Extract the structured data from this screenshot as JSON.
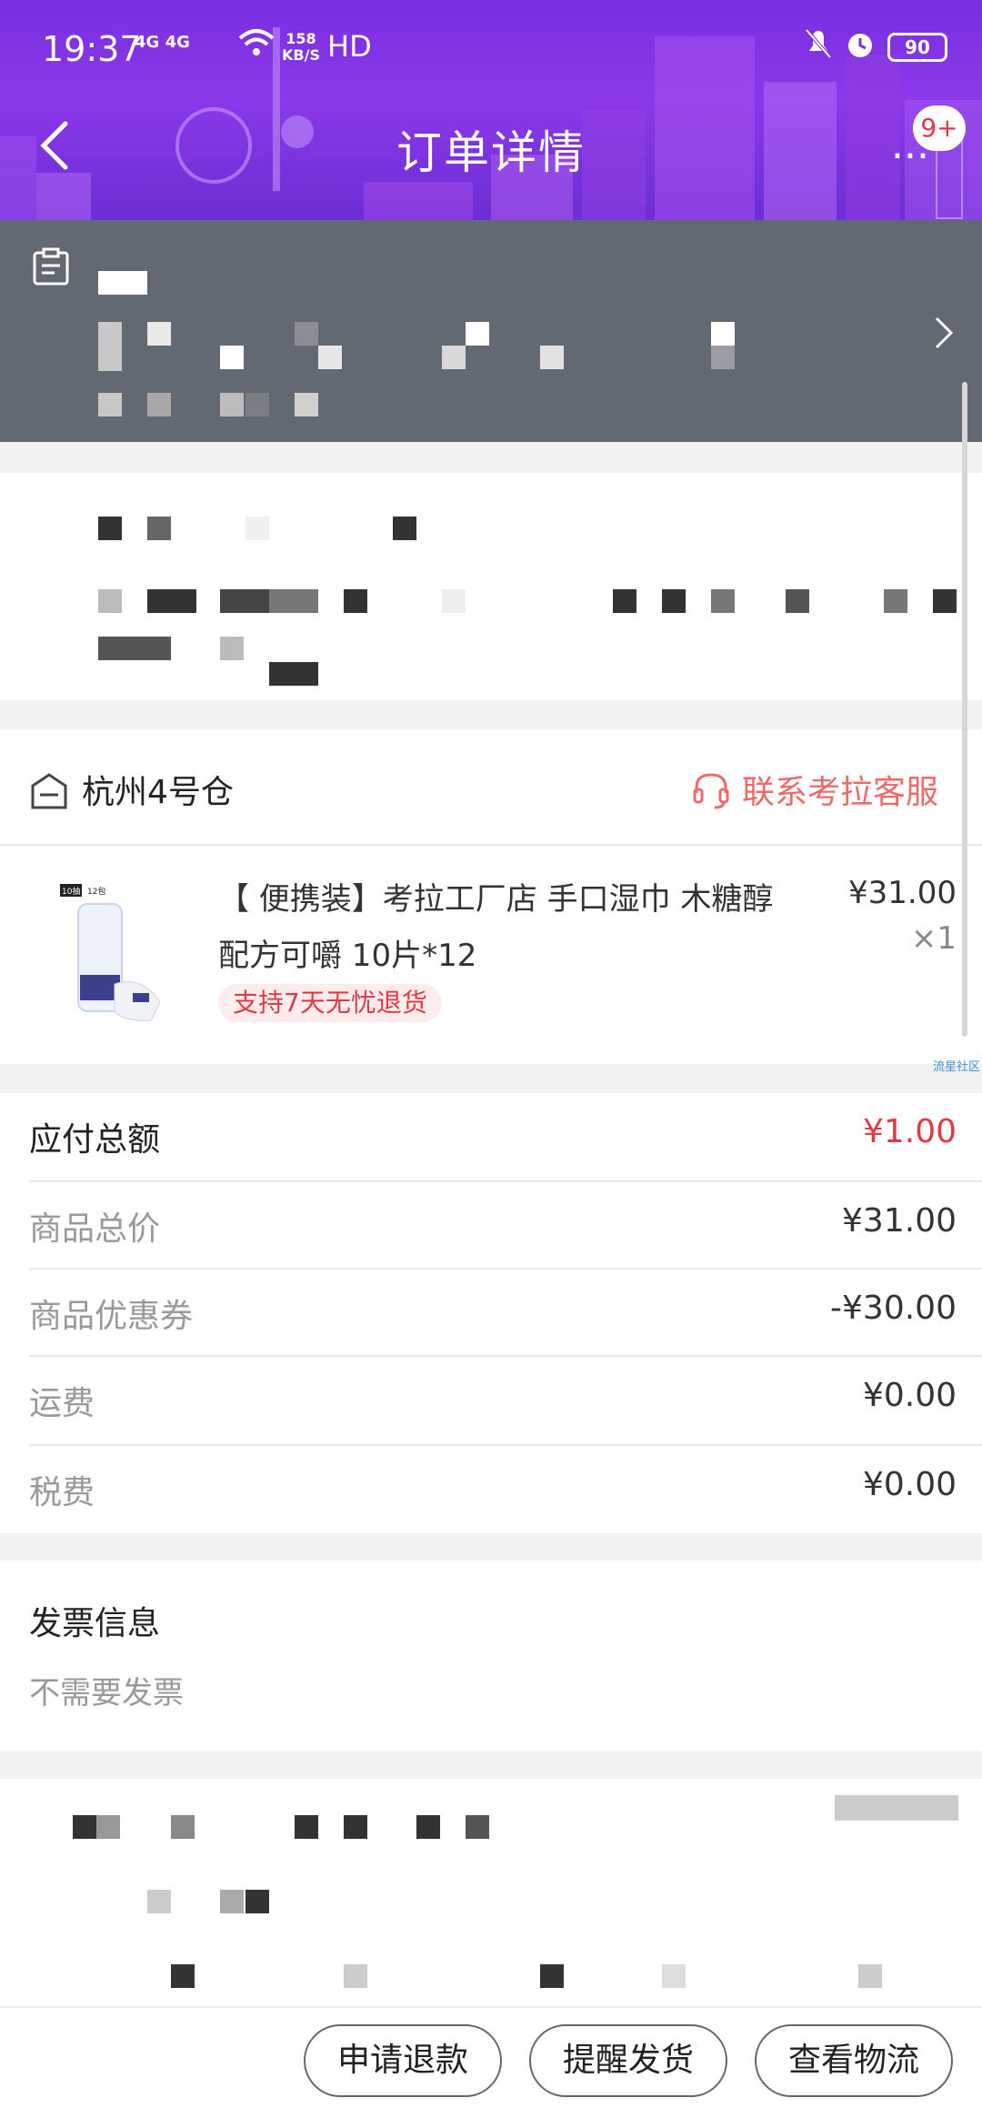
{
  "status_bar": {
    "time": "19:37",
    "network": "4G 4G",
    "speed_value": "158",
    "speed_unit": "KB/S",
    "hd": "HD",
    "battery": "90"
  },
  "nav": {
    "title": "订单详情",
    "more": "...",
    "badge": "9+"
  },
  "warehouse": {
    "name": "杭州4号仓",
    "contact_label": "联系考拉客服"
  },
  "product": {
    "title": "【 便携装】考拉工厂店 手口湿巾 木糖醇配方可嚼 10片*12",
    "price": "¥31.00",
    "quantity": "×1",
    "return_tag": "支持7天无忧退货",
    "image_label_left": "10抽",
    "image_label_right": "12包"
  },
  "watermark": "流星社区",
  "fees": {
    "total_label": "应付总额",
    "total_value": "¥1.00",
    "items": [
      {
        "label": "商品总价",
        "value": "¥31.00"
      },
      {
        "label": "商品优惠券",
        "value": "-¥30.00"
      },
      {
        "label": "运费",
        "value": "¥0.00"
      },
      {
        "label": "税费",
        "value": "¥0.00"
      }
    ]
  },
  "invoice": {
    "title": "发票信息",
    "value": "不需要发票"
  },
  "buttons": {
    "refund": "申请退款",
    "remind": "提醒发货",
    "logistics": "查看物流"
  },
  "colors": {
    "header": "#7a2fe0",
    "accent_red": "#e23a44",
    "contact": "#ee6a6a",
    "address_bg": "#636973"
  }
}
